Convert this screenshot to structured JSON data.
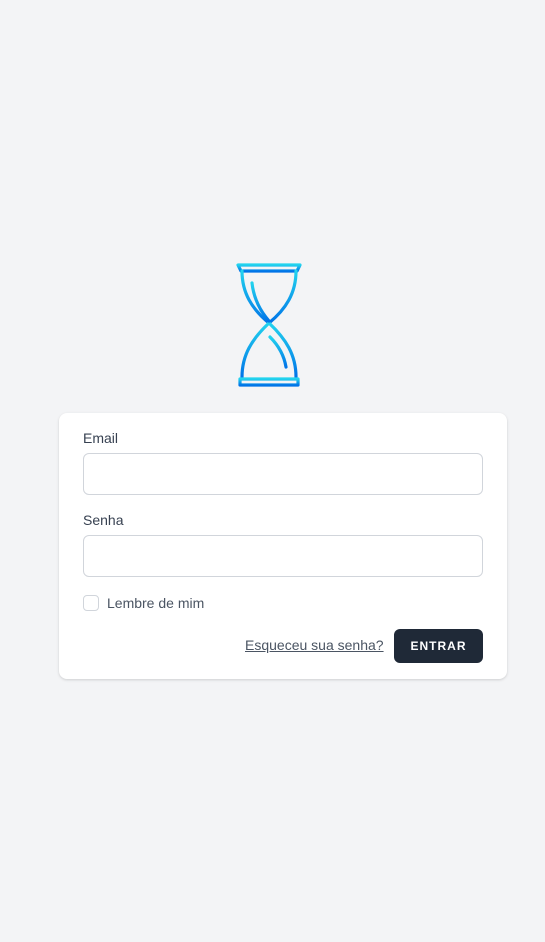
{
  "logo": {
    "icon": "hourglass-icon",
    "gradient_start": "#22d3ee",
    "gradient_end": "#0074e8"
  },
  "form": {
    "email_label": "Email",
    "email_value": "",
    "password_label": "Senha",
    "password_value": "",
    "remember_label": "Lembre de mim",
    "remember_checked": false,
    "forgot_link": "Esqueceu sua senha?",
    "submit_label": "ENTRAR"
  },
  "colors": {
    "background": "#f3f4f6",
    "card": "#ffffff",
    "button": "#1f2937"
  }
}
